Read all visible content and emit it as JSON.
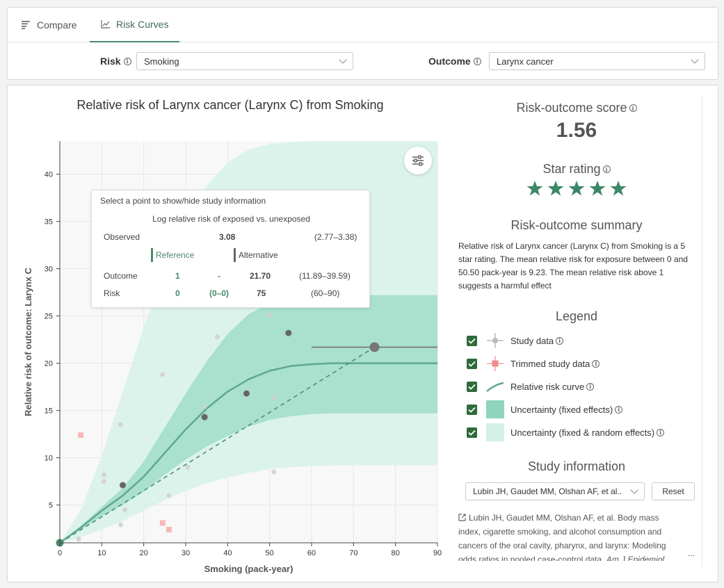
{
  "tabs": [
    {
      "label": "Compare",
      "icon": "list-icon"
    },
    {
      "label": "Risk Curves",
      "icon": "line-chart-icon",
      "active": true
    }
  ],
  "controls": {
    "risk_label": "Risk",
    "risk_value": "Smoking",
    "outcome_label": "Outcome",
    "outcome_value": "Larynx cancer"
  },
  "tooltip": {
    "hint": "Select a point to show/hide study information",
    "header": "Log relative risk of exposed vs. unexposed",
    "observed_label": "Observed",
    "observed_value": "3.08",
    "observed_ci": "(2.77–3.38)",
    "reference_label": "Reference",
    "alternative_label": "Alternative",
    "outcome_label": "Outcome",
    "outcome_ref": "1",
    "outcome_ref_ci": "-",
    "outcome_alt": "21.70",
    "outcome_alt_ci": "(11.89–39.59)",
    "risk_label": "Risk",
    "risk_ref": "0",
    "risk_ref_ci": "(0–0)",
    "risk_alt": "75",
    "risk_alt_ci": "(60–90)"
  },
  "panel": {
    "score_title": "Risk-outcome score",
    "score_value": "1.56",
    "star_title": "Star rating",
    "stars": 5,
    "summary_title": "Risk-outcome summary",
    "summary_text": "Relative risk of Larynx cancer (Larynx C) from Smoking is a 5 star rating. The mean relative risk for exposure between 0 and 50.50 pack-year is 9.23. The mean relative risk above 1 suggests a harmful effect",
    "legend_title": "Legend",
    "legend": [
      {
        "label": "Study data",
        "symbol": "study-data-icon"
      },
      {
        "label": "Trimmed study data",
        "symbol": "trimmed-data-icon"
      },
      {
        "label": "Relative risk curve",
        "symbol": "curve-icon"
      },
      {
        "label": "Uncertainty (fixed effects)",
        "symbol": "fixed-band-icon"
      },
      {
        "label": "Uncertainty (fixed & random effects)",
        "symbol": "random-band-icon"
      }
    ],
    "study_title": "Study information",
    "study_select": "Lubin JH, Gaudet MM, Olshan AF, et al..",
    "reset_label": "Reset",
    "citation_plain": "Lubin JH, Gaudet MM, Olshan AF, et al. Body mass index, cigarette smoking, and alcohol consumption and cancers of the oral cavity, pharynx, and larynx: Modeling odds ratios in pooled case-control data.",
    "citation_journal": "Am J Epidemiol.",
    "ellipsis": "..."
  },
  "colors": {
    "accent": "#4a8a6a",
    "curve": "#5fa88e",
    "band_fixed": "#a9e0ce",
    "band_random": "#dcf3ec",
    "star": "#3b8767",
    "checkbox": "#2f6b3b",
    "trimmed": "#f2a3a3"
  },
  "chart_data": {
    "type": "line",
    "title": "Relative risk of Larynx cancer (Larynx C) from Smoking",
    "xlabel": "Smoking (pack-year)",
    "ylabel": "Relative risk of outcome: Larynx C",
    "xlim": [
      0,
      90
    ],
    "ylim": [
      1,
      43.5
    ],
    "xticks": [
      0,
      10,
      20,
      30,
      40,
      50,
      60,
      70,
      80,
      90
    ],
    "yticks": [
      5,
      10,
      15,
      20,
      25,
      30,
      35,
      40
    ],
    "grid": true,
    "curve": {
      "x": [
        0,
        5,
        10,
        15,
        20,
        25,
        30,
        35,
        40,
        45,
        50,
        55,
        60,
        65,
        70,
        75,
        80,
        85,
        90
      ],
      "y": [
        1,
        2.6,
        4.4,
        6.0,
        8.0,
        10.5,
        13.0,
        15.2,
        17.0,
        18.3,
        19.2,
        19.7,
        19.9,
        20.0,
        20.0,
        20.0,
        20.0,
        20.0,
        20.0
      ]
    },
    "fixed_band": {
      "x": [
        0,
        5,
        10,
        15,
        20,
        25,
        30,
        35,
        40,
        45,
        50,
        55,
        60,
        65,
        70,
        75,
        80,
        85,
        90
      ],
      "lower": [
        1,
        2.4,
        3.8,
        5.0,
        6.4,
        8.2,
        9.8,
        11.2,
        12.3,
        13.3,
        14.0,
        14.4,
        14.6,
        14.7,
        14.7,
        14.7,
        14.7,
        14.7,
        14.7
      ],
      "upper": [
        1,
        2.8,
        4.8,
        6.8,
        9.6,
        13.2,
        16.8,
        20.2,
        23.1,
        25.2,
        26.3,
        26.9,
        27.1,
        27.2,
        27.2,
        27.2,
        27.2,
        27.2,
        27.2
      ]
    },
    "random_band": {
      "x": [
        0,
        5,
        10,
        15,
        20,
        25,
        30,
        35,
        40,
        45,
        50,
        55,
        60,
        65,
        70,
        75,
        80,
        85,
        90
      ],
      "lower": [
        1,
        1.6,
        2.4,
        3.3,
        4.4,
        5.5,
        6.5,
        7.3,
        7.9,
        8.4,
        8.8,
        9.0,
        9.1,
        9.2,
        9.2,
        9.2,
        9.2,
        9.2,
        9.2
      ],
      "upper": [
        1,
        4.5,
        10.2,
        17.0,
        23.8,
        30.0,
        35.0,
        38.8,
        41.2,
        42.6,
        43.2,
        43.4,
        43.5,
        43.5,
        43.5,
        43.5,
        43.5,
        43.5,
        43.5
      ]
    },
    "alternative_line": {
      "x": [
        0,
        75
      ],
      "y": [
        1,
        21.7
      ]
    },
    "selected_point": {
      "x": 75,
      "y": 21.7,
      "xerr": [
        60,
        90
      ]
    },
    "study_points": [
      {
        "x": 0,
        "y": 1,
        "kind": "reference"
      },
      {
        "x": 15,
        "y": 7.1,
        "kind": "study"
      },
      {
        "x": 34.5,
        "y": 14.3,
        "kind": "study"
      },
      {
        "x": 44.5,
        "y": 16.8,
        "kind": "study"
      },
      {
        "x": 54.5,
        "y": 23.2,
        "kind": "study"
      },
      {
        "x": 4.5,
        "y": 1.4,
        "kind": "faded"
      },
      {
        "x": 10.5,
        "y": 8.2,
        "kind": "faded"
      },
      {
        "x": 10.5,
        "y": 7.5,
        "kind": "faded"
      },
      {
        "x": 14.5,
        "y": 13.5,
        "kind": "faded"
      },
      {
        "x": 14.5,
        "y": 2.9,
        "kind": "faded"
      },
      {
        "x": 15.5,
        "y": 4.5,
        "kind": "faded"
      },
      {
        "x": 24.5,
        "y": 18.8,
        "kind": "faded"
      },
      {
        "x": 26,
        "y": 6.0,
        "kind": "faded"
      },
      {
        "x": 30.5,
        "y": 9.0,
        "kind": "faded"
      },
      {
        "x": 34.5,
        "y": 15.4,
        "kind": "faded"
      },
      {
        "x": 37.5,
        "y": 22.8,
        "kind": "faded"
      },
      {
        "x": 50,
        "y": 25.1,
        "kind": "faded"
      },
      {
        "x": 51,
        "y": 16.3,
        "kind": "faded"
      },
      {
        "x": 51,
        "y": 8.5,
        "kind": "faded"
      }
    ],
    "trimmed_points": [
      {
        "x": 5,
        "y": 12.4
      },
      {
        "x": 24.5,
        "y": 3.1
      },
      {
        "x": 26,
        "y": 2.4
      }
    ]
  }
}
